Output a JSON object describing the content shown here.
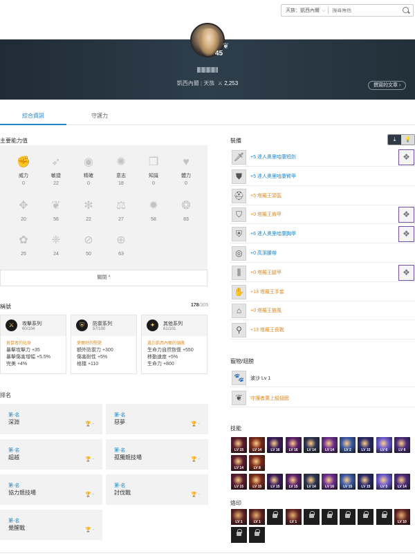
{
  "search": {
    "server": "天族：凱西內爾",
    "placeholder": "搜尋角色"
  },
  "profile": {
    "level": "45",
    "server": "凱西內爾",
    "race": "天族",
    "gear_score": "2,253",
    "written_button": "撰寫的文章"
  },
  "tabs": [
    "綜合資訊",
    "守護力"
  ],
  "stats": {
    "title": "主要能力值",
    "items": [
      {
        "label": "威力",
        "value": "0",
        "icon": "fist-icon"
      },
      {
        "label": "敏捷",
        "value": "22",
        "icon": "feather-icon"
      },
      {
        "label": "精確",
        "value": "0",
        "icon": "eye-icon"
      },
      {
        "label": "意志",
        "value": "18",
        "icon": "flame-icon"
      },
      {
        "label": "知識",
        "value": "0",
        "icon": "book-icon"
      },
      {
        "label": "體力",
        "value": "0",
        "icon": "heart-icon"
      },
      {
        "label": "",
        "value": "20",
        "icon": "wing-emblem-icon"
      },
      {
        "label": "",
        "value": "56",
        "icon": "leaf-emblem-icon"
      },
      {
        "label": "",
        "value": "22",
        "icon": "snowflake-emblem-icon"
      },
      {
        "label": "",
        "value": "27",
        "icon": "scale-emblem-icon"
      },
      {
        "label": "",
        "value": "58",
        "icon": "sun-emblem-icon"
      },
      {
        "label": "",
        "value": "83",
        "icon": "gear-emblem-icon"
      },
      {
        "label": "",
        "value": "25",
        "icon": "flower-emblem-icon"
      },
      {
        "label": "",
        "value": "24",
        "icon": "butterfly-emblem-icon"
      },
      {
        "label": "",
        "value": "50",
        "icon": "slash-emblem-icon"
      },
      {
        "label": "",
        "value": "63",
        "icon": "shield-emblem-icon"
      }
    ],
    "collapse_label": "關閉 ^"
  },
  "titles": {
    "title": "稱號",
    "count": "178",
    "total": "/305",
    "cards": [
      {
        "name": "攻擊系列",
        "count": "60",
        "total": "/104",
        "subtitle": "貪婪者的化身",
        "lines": [
          "暴擊攻擊力 +35",
          "暴擊傷害增幅 +5.5%",
          "完美 +4%"
        ]
      },
      {
        "name": "防禦系列",
        "count": "57",
        "total": "/100",
        "subtitle": "愛爾特的堅壁",
        "lines": [
          "額外防禦力 +300",
          "傷害耐性 +5%",
          "格擋 +110"
        ]
      },
      {
        "name": "其他系列",
        "count": "61",
        "total": "/101",
        "subtitle": "遺忘凱西內爾的領路",
        "lines": [
          "生命力自然恢復 +550",
          "移動速度 +5%",
          "生命力 +800"
        ]
      }
    ]
  },
  "ranking": {
    "title": "排名",
    "items": [
      {
        "cap": "第-名",
        "name": "深淵",
        "value": "-"
      },
      {
        "cap": "第-名",
        "name": "惡夢",
        "value": "-"
      },
      {
        "cap": "第-名",
        "name": "超越",
        "value": "-"
      },
      {
        "cap": "第-名",
        "name": "孤獨競技場",
        "value": "-"
      },
      {
        "cap": "第-名",
        "name": "協力競技場",
        "value": "-"
      },
      {
        "cap": "第-名",
        "name": "討伐戰",
        "value": "-"
      },
      {
        "cap": "第-名",
        "name": "覺醒戰",
        "value": "-"
      }
    ]
  },
  "equipment": {
    "title": "裝備",
    "items": [
      {
        "name": "+5 達人奧里哈康短劍",
        "color": "blue",
        "icon": "dagger-icon",
        "gem": "sword-gem-icon"
      },
      {
        "name": "+5 達人奧里哈康臂甲",
        "color": "blue",
        "icon": "arm-guard-icon",
        "gem": ""
      },
      {
        "name": "+5 塔羅王頭盔",
        "color": "orange",
        "icon": "helmet-icon",
        "gem": ""
      },
      {
        "name": "+0 塔羅王肩甲",
        "color": "orange",
        "icon": "shoulder-icon",
        "gem": "claw-gem-icon"
      },
      {
        "name": "+6 達人奧里哈康胸甲",
        "color": "blue",
        "icon": "chest-armor-icon",
        "gem": "armor-gem-icon"
      },
      {
        "name": "+0 高潔腰帶",
        "color": "blue",
        "icon": "belt-icon",
        "gem": ""
      },
      {
        "name": "+0 塔羅王腿甲",
        "color": "orange",
        "icon": "leggings-icon",
        "gem": "pants-gem-icon"
      },
      {
        "name": "+13 塔羅王手套",
        "color": "orange",
        "icon": "glove-icon",
        "gem": ""
      },
      {
        "name": "+0 塔羅王披風",
        "color": "orange",
        "icon": "cape-icon",
        "gem": ""
      },
      {
        "name": "+13 塔羅王長靴",
        "color": "orange",
        "icon": "boots-icon",
        "gem": ""
      }
    ]
  },
  "pets": {
    "title": "寵物/翅膀",
    "items": [
      {
        "name": "波沙 Lv 1",
        "color": "plain",
        "icon": "pet-icon"
      },
      {
        "name": "守護者廣上級翅膀",
        "color": "orange",
        "icon": "wing-icon"
      }
    ]
  },
  "skills": {
    "title": "技能",
    "row1": [
      "LV 15",
      "LV 14",
      "LV 16",
      "LV 16",
      "LV 14",
      "LV 14",
      "LV 2",
      "LV 15",
      "LV 6",
      "LV 6"
    ],
    "row2": [
      "LV 14",
      "LV 8"
    ],
    "row3": [
      "LV 15",
      "LV 15",
      "LV 15",
      "LV 15",
      "LV 14",
      "LV 16",
      "LV 15",
      "LV 15",
      "LV 5",
      "LV 14"
    ],
    "colors": [
      "#5a1b2c",
      "#7a2a1a",
      "#3a1d5a",
      "#5b1f6a",
      "#2b3350",
      "#6b2e8e",
      "#3c5aa7",
      "#2a2a6a",
      "#6a5ad0",
      "#4b2a7a"
    ]
  },
  "stigma": {
    "title": "烙印",
    "row1": [
      "LV 1",
      "LV 1",
      "",
      "LV 1",
      "",
      "",
      "",
      "",
      "",
      "LV 10"
    ],
    "row2": [
      "",
      ""
    ]
  }
}
